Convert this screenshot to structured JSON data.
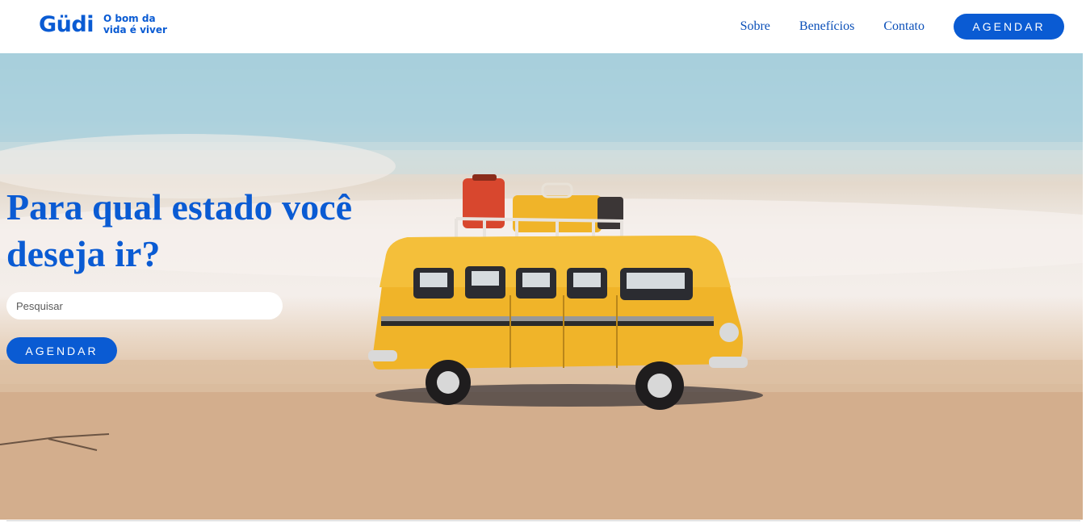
{
  "header": {
    "logo_text": "Güdi",
    "tagline": "O bom da vida é viver",
    "nav": [
      {
        "label": "Sobre"
      },
      {
        "label": "Benefícios"
      },
      {
        "label": "Contato"
      }
    ],
    "cta_label": "AGENDAR"
  },
  "hero": {
    "title": "Para qual estado você deseja ir?",
    "search": {
      "placeholder": "Pesquisar",
      "value": ""
    },
    "cta_label": "AGENDAR",
    "image": "toy-yellow-van-on-beach"
  },
  "colors": {
    "brand": "#0a5bd3",
    "nav_link": "#0a4fb8",
    "van": "#f0b429"
  }
}
